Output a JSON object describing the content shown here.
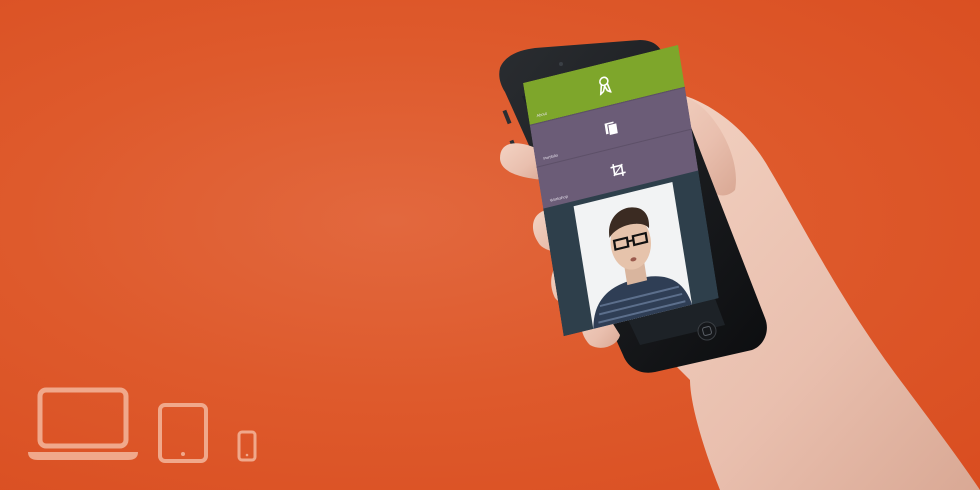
{
  "background_color": "#de5a2c",
  "device_icons": [
    "laptop-icon",
    "tablet-icon",
    "smartphone-icon"
  ],
  "phone": {
    "menu": [
      {
        "label": "About",
        "icon": "ribbon-icon",
        "color": "#7ea62b"
      },
      {
        "label": "Portfolio",
        "icon": "documents-icon",
        "color": "#6b5c77"
      },
      {
        "label": "Workshop",
        "icon": "crop-icon",
        "color": "#6b5c77"
      }
    ],
    "photo": "man-with-glasses-portrait"
  }
}
